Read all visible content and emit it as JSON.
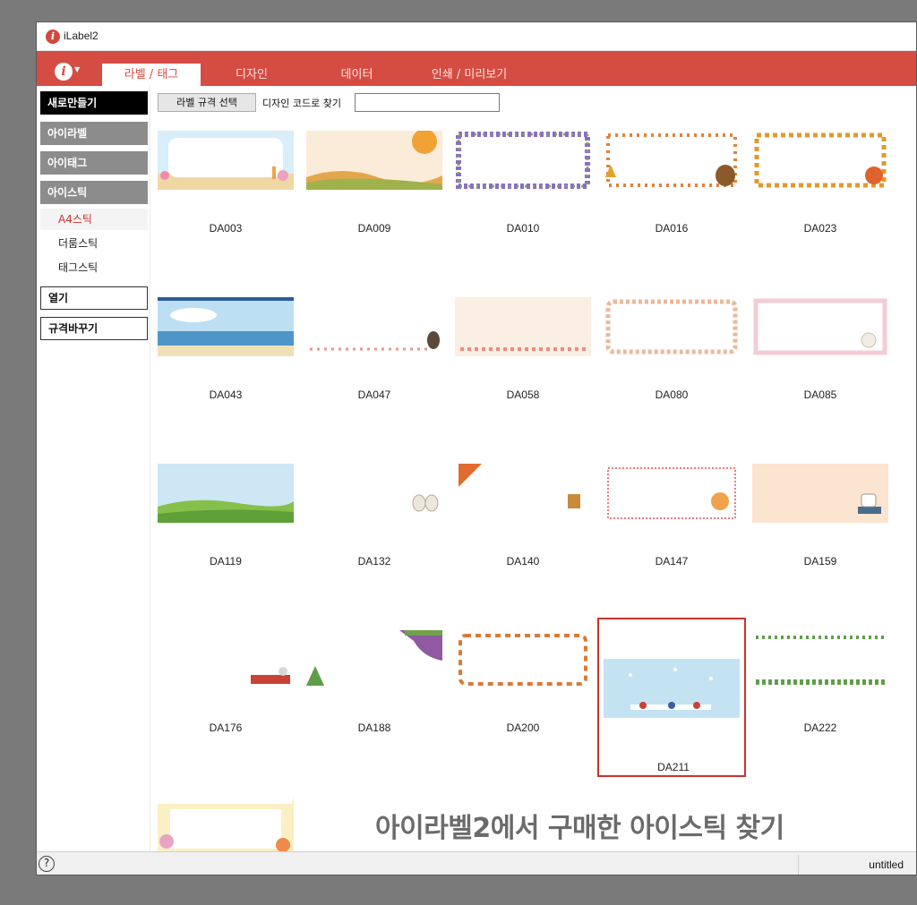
{
  "window": {
    "title": "iLabel2",
    "app_icon": "app-logo-icon"
  },
  "menu": {
    "info_icon": "info-icon",
    "tabs": [
      {
        "label": "라벨 / 태그",
        "active": true
      },
      {
        "label": "디자인",
        "active": false
      },
      {
        "label": "데이터",
        "active": false
      },
      {
        "label": "인쇄 / 미리보기",
        "active": false
      }
    ]
  },
  "sidebar": {
    "new": "새로만들기",
    "categories": [
      "아이라벨",
      "아이태그",
      "아이스틱"
    ],
    "subitems": [
      {
        "label": "A4스틱",
        "active": true
      },
      {
        "label": "더룸스틱",
        "active": false
      },
      {
        "label": "태그스틱",
        "active": false
      }
    ],
    "open": "열기",
    "change_spec": "규격바꾸기"
  },
  "toolbar": {
    "spec_button": "라벨 규격 선택",
    "code_search_label": "디자인 코드로 찾기",
    "code_search_value": ""
  },
  "designs": [
    {
      "code": "DA003"
    },
    {
      "code": "DA009"
    },
    {
      "code": "DA010"
    },
    {
      "code": "DA016"
    },
    {
      "code": "DA023"
    },
    {
      "code": "DA043"
    },
    {
      "code": "DA047"
    },
    {
      "code": "DA058"
    },
    {
      "code": "DA080"
    },
    {
      "code": "DA085"
    },
    {
      "code": "DA119"
    },
    {
      "code": "DA132"
    },
    {
      "code": "DA140"
    },
    {
      "code": "DA147"
    },
    {
      "code": "DA159"
    },
    {
      "code": "DA176"
    },
    {
      "code": "DA188"
    },
    {
      "code": "DA200"
    },
    {
      "code": "DA211",
      "selected": true
    },
    {
      "code": "DA222"
    }
  ],
  "banner": "아이라벨2에서 구매한 아이스틱 찾기",
  "status": {
    "help_icon": "help-icon",
    "text": "untitled"
  },
  "colors": {
    "accent": "#d54c42",
    "selected_border": "#c9332b"
  }
}
